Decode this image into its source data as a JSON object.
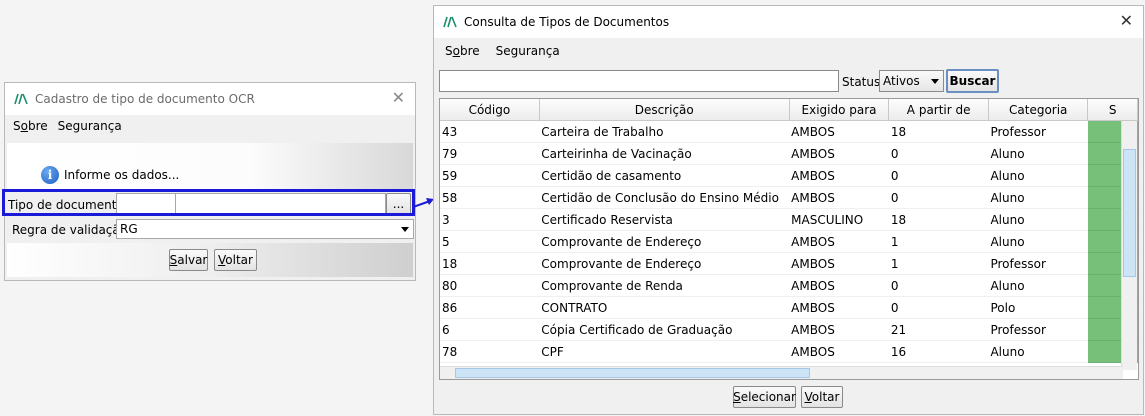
{
  "left_window": {
    "title": "Cadastro de tipo de documento OCR",
    "close": "✕",
    "menu": [
      "Sobre",
      "Segurança"
    ],
    "info_text": "Informe os dados...",
    "info_icon": "i",
    "doc_type_label": "Tipo de documento:",
    "lookup_button": "...",
    "validation_label": "Regra de validação:",
    "validation_value": "RG",
    "save_button": "Salvar",
    "back_button": "Voltar"
  },
  "right_window": {
    "title": "Consulta de Tipos de Documentos",
    "close": "✕",
    "menu": [
      "Sobre",
      "Segurança"
    ],
    "search_placeholder": "",
    "status_label": "Status:",
    "status_value": "Ativos",
    "search_button": "Buscar",
    "columns": [
      "Código",
      "Descrição",
      "Exigido para",
      "A partir de",
      "Categoria",
      "S"
    ],
    "rows": [
      [
        "43",
        "Carteira de Trabalho",
        "AMBOS",
        "18",
        "Professor"
      ],
      [
        "79",
        "Carteirinha de Vacinação",
        "AMBOS",
        "0",
        "Aluno"
      ],
      [
        "59",
        "Certidão de casamento",
        "AMBOS",
        "0",
        "Aluno"
      ],
      [
        "58",
        "Certidão de Conclusão do Ensino Médio",
        "AMBOS",
        "0",
        "Aluno"
      ],
      [
        "3",
        "Certificado Reservista",
        "MASCULINO",
        "18",
        "Aluno"
      ],
      [
        "5",
        "Comprovante de Endereço",
        "AMBOS",
        "1",
        "Aluno"
      ],
      [
        "18",
        "Comprovante de Endereço",
        "AMBOS",
        "1",
        "Professor"
      ],
      [
        "80",
        "Comprovante de Renda",
        "AMBOS",
        "0",
        "Aluno"
      ],
      [
        "86",
        "CONTRATO",
        "AMBOS",
        "0",
        "Polo"
      ],
      [
        "6",
        "Cópia Certificado de Graduação",
        "AMBOS",
        "21",
        "Professor"
      ],
      [
        "78",
        "CPF",
        "AMBOS",
        "16",
        "Aluno"
      ]
    ],
    "select_button": "Selecionar",
    "back_button": "Voltar"
  },
  "colors": {
    "highlight_border": "#1a1ad8",
    "status_cell": "#77c07a",
    "brand": "#1a8f6e"
  }
}
